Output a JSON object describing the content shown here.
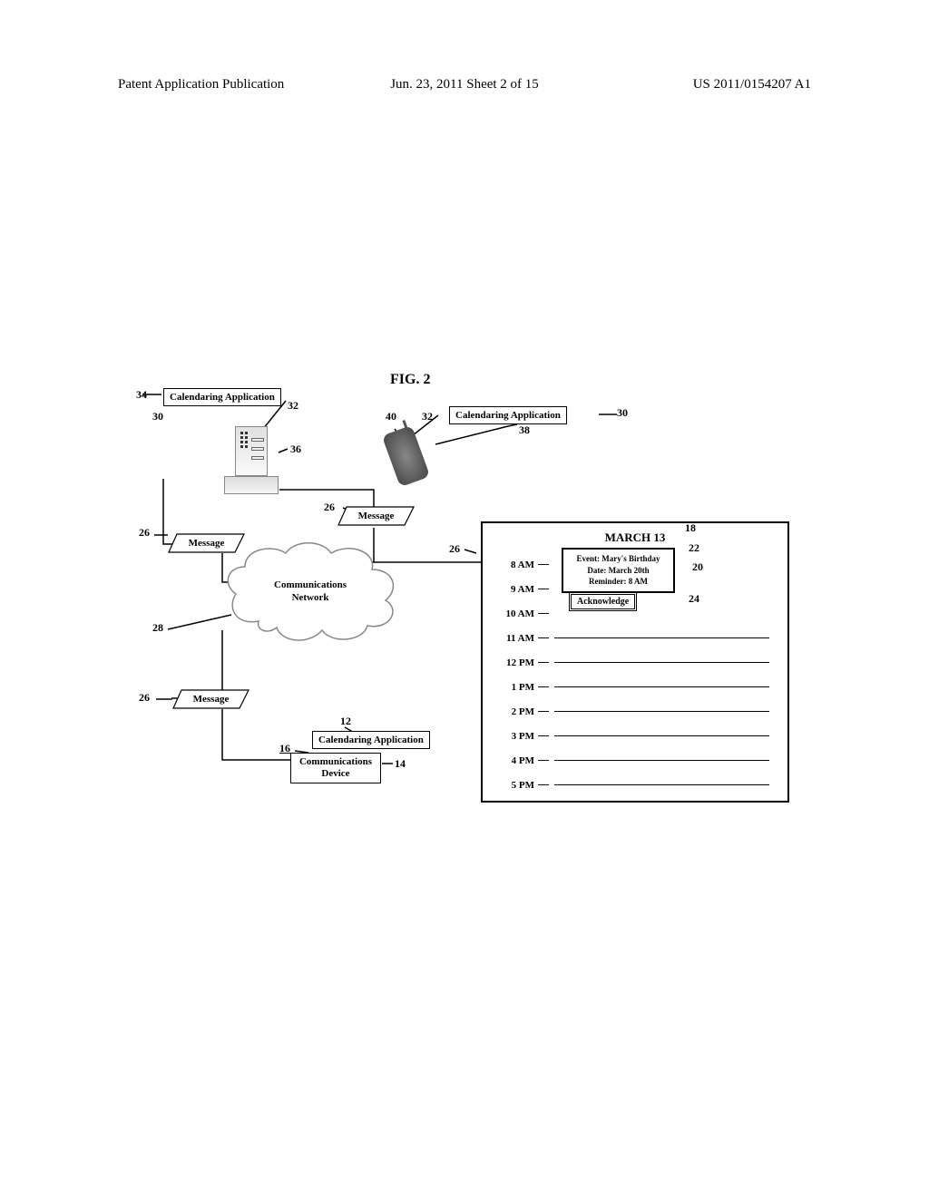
{
  "header": {
    "left": "Patent Application Publication",
    "center": "Jun. 23, 2011  Sheet 2 of 15",
    "right": "US 2011/0154207 A1"
  },
  "figure_title": "FIG. 2",
  "labels": {
    "calendaring_app": "Calendaring Application",
    "message": "Message",
    "comm_network": "Communications\nNetwork",
    "comm_device": "Communications\nDevice"
  },
  "refs": {
    "r34": "34",
    "r30a": "30",
    "r32a": "32",
    "r36": "36",
    "r40": "40",
    "r32b": "32",
    "r30b": "30",
    "r38": "38",
    "r26a": "26",
    "r26b": "26",
    "r26c": "26",
    "r26d": "26",
    "r28": "28",
    "r12": "12",
    "r16": "16",
    "r14": "14",
    "r18": "18",
    "r22": "22",
    "r20": "20",
    "r24": "24"
  },
  "calendar": {
    "title": "MARCH 13",
    "hours": [
      "8 AM",
      "9 AM",
      "10 AM",
      "11 AM",
      "12 PM",
      "1 PM",
      "2 PM",
      "3 PM",
      "4 PM",
      "5 PM"
    ],
    "reminder": {
      "line1": "Event: Mary's Birthday",
      "line2": "Date: March 20th",
      "line3": "Reminder: 8 AM"
    },
    "ack": "Acknowledge"
  }
}
